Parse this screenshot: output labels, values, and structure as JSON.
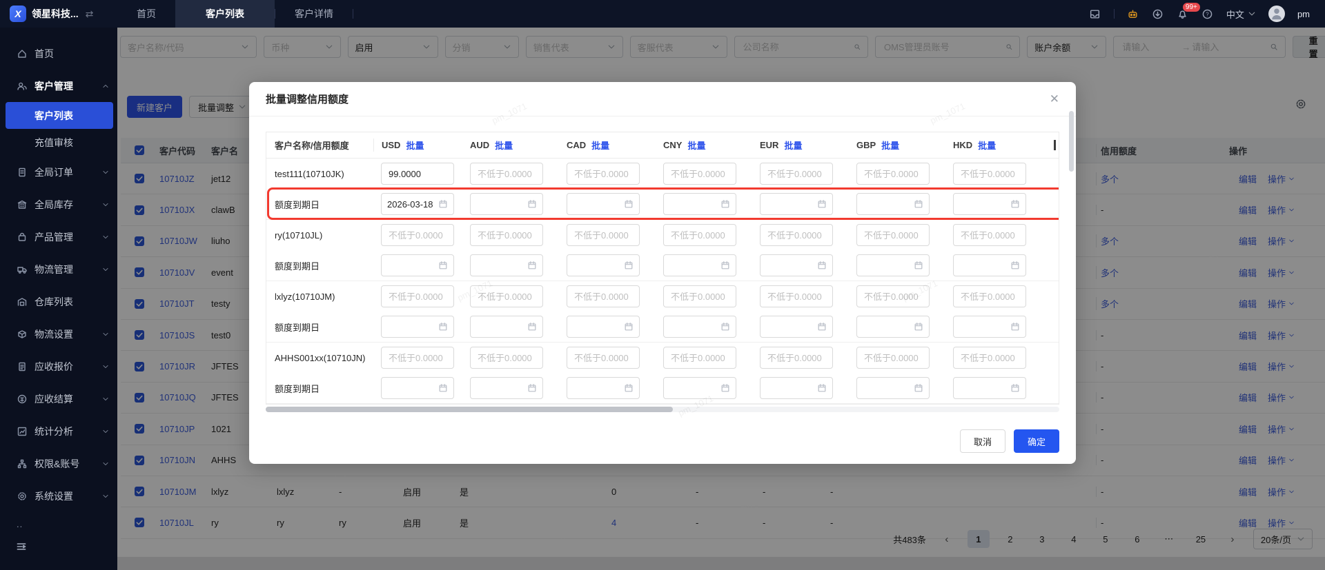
{
  "watermark": "pm_1071",
  "topbar": {
    "logo_text": "领星科技...",
    "tabs": [
      {
        "label": "首页",
        "active": false
      },
      {
        "label": "客户列表",
        "active": true
      },
      {
        "label": "客户详情",
        "active": false
      }
    ],
    "right": {
      "badge": "99+",
      "lang": "中文",
      "user": "pm"
    }
  },
  "sidebar": {
    "items": [
      {
        "label": "首页",
        "icon": "home-icon",
        "type": "top"
      },
      {
        "label": "客户管理",
        "icon": "users-icon",
        "type": "group",
        "expanded": true,
        "active_group": true
      },
      {
        "label": "客户列表",
        "type": "child",
        "active": true
      },
      {
        "label": "充值审核",
        "type": "child"
      },
      {
        "label": "全局订单",
        "icon": "order-icon",
        "type": "group"
      },
      {
        "label": "全局库存",
        "icon": "inventory-icon",
        "type": "group"
      },
      {
        "label": "产品管理",
        "icon": "product-icon",
        "type": "group"
      },
      {
        "label": "物流管理",
        "icon": "logistics-icon",
        "type": "group"
      },
      {
        "label": "仓库列表",
        "icon": "warehouse-icon",
        "type": "top"
      },
      {
        "label": "物流设置",
        "icon": "box-icon",
        "type": "group"
      },
      {
        "label": "应收报价",
        "icon": "quote-icon",
        "type": "group"
      },
      {
        "label": "应收结算",
        "icon": "coin-icon",
        "type": "group"
      },
      {
        "label": "统计分析",
        "icon": "stats-icon",
        "type": "group"
      },
      {
        "label": "权限&账号",
        "icon": "org-icon",
        "type": "group"
      },
      {
        "label": "系统设置",
        "icon": "gear-icon",
        "type": "group"
      }
    ],
    "more_dots": ".."
  },
  "filters": {
    "dropdowns": [
      {
        "label": "客户名称/代码",
        "selected": false
      },
      {
        "label": "币种",
        "selected": false
      },
      {
        "label": "启用",
        "selected": true
      },
      {
        "label": "分销",
        "selected": false
      },
      {
        "label": "销售代表",
        "selected": false
      },
      {
        "label": "客服代表",
        "selected": false
      }
    ],
    "search_company": "公司名称",
    "search_oms": "OMS管理员账号",
    "balance_label": "账户余额",
    "range_placeholder_min": "请输入",
    "range_placeholder_max": "请输入",
    "reset_label": "重置"
  },
  "toolbar": {
    "new_customer": "新建客户",
    "batch_adjust": "批量调整"
  },
  "table": {
    "headers": {
      "code": "客户代码",
      "name": "客户名",
      "credit": "信用额度",
      "action": "操作"
    },
    "action_labels": {
      "edit": "编辑",
      "more": "操作"
    },
    "rows": [
      {
        "code": "10710JZ",
        "name": "jet12",
        "credit": "多个"
      },
      {
        "code": "10710JX",
        "name": "clawB",
        "credit": "-"
      },
      {
        "code": "10710JW",
        "name": "liuho",
        "credit": "多个"
      },
      {
        "code": "10710JV",
        "name": "event",
        "credit": "多个"
      },
      {
        "code": "10710JT",
        "name": "testy",
        "credit": "多个"
      },
      {
        "code": "10710JS",
        "name": "test0",
        "credit": "-"
      },
      {
        "code": "10710JR",
        "name": "JFTES",
        "credit": "-"
      },
      {
        "code": "10710JQ",
        "name": "JFTES",
        "credit": "-"
      },
      {
        "code": "10710JP",
        "name": "1021",
        "credit": "-"
      },
      {
        "code": "10710JN",
        "name": "AHHS",
        "credit": "-"
      },
      {
        "code": "10710JM",
        "name": "lxlyz",
        "cells": [
          "lxlyz",
          "-",
          "启用",
          "是",
          "0",
          "-",
          "-",
          "-"
        ],
        "count_link": false,
        "credit": "-"
      },
      {
        "code": "10710JL",
        "name": "ry",
        "cells": [
          "ry",
          "ry",
          "启用",
          "是",
          "4",
          "-",
          "-",
          "-"
        ],
        "count_link": true,
        "credit": "-"
      }
    ]
  },
  "pagination": {
    "total": "共483条",
    "pages": [
      "1",
      "2",
      "3",
      "4",
      "5",
      "6",
      "⋯",
      "25"
    ],
    "active_page": "1",
    "page_size": "20条/页"
  },
  "modal": {
    "title": "批量调整信用额度",
    "table": {
      "label_header": "客户名称/信用额度",
      "batch_label": "批量",
      "currencies": [
        "USD",
        "AUD",
        "CAD",
        "CNY",
        "EUR",
        "GBP",
        "HKD"
      ],
      "amount_placeholder": "不低于0.0000",
      "date_row_label": "额度到期日",
      "customers": [
        {
          "label": "test111(10710JK)",
          "usd_value": "99.0000",
          "date_usd": "2026-03-18",
          "date_highlighted": true
        },
        {
          "label": "ry(10710JL)"
        },
        {
          "label": "lxlyz(10710JM)"
        },
        {
          "label": "AHHS001xx(10710JN)"
        }
      ]
    },
    "footer": {
      "cancel": "取消",
      "confirm": "确定"
    }
  },
  "colors": {
    "accent_blue": "#2f54eb",
    "highlight_red": "#f23a2f",
    "confirm_blue": "#2456f0",
    "active_sidebar": "#2a4fd7"
  }
}
